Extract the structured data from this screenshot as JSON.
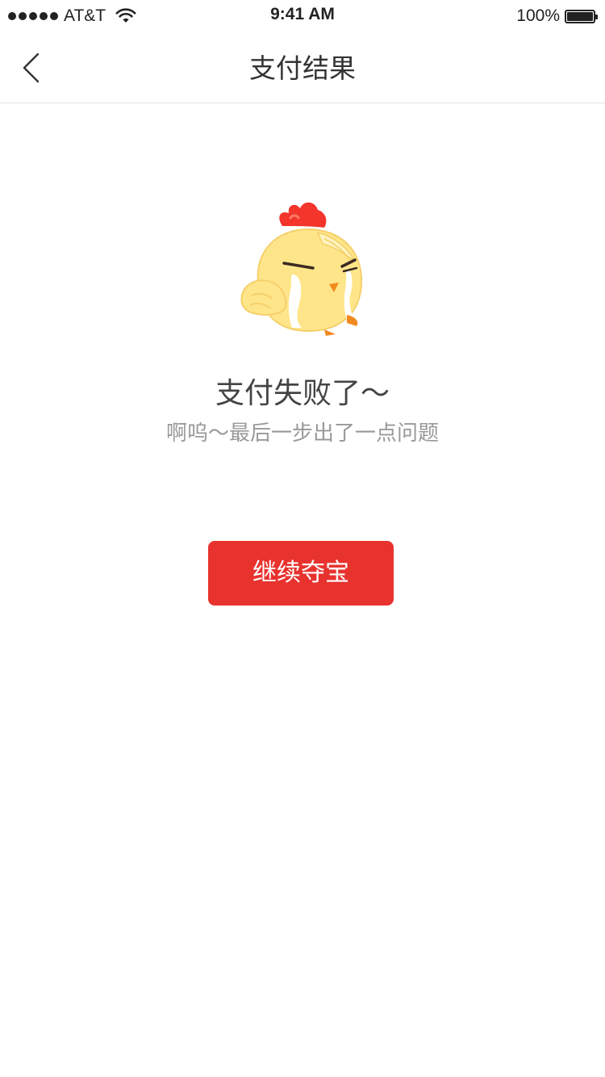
{
  "status_bar": {
    "carrier": "AT&T",
    "time": "9:41 AM",
    "battery": "100%"
  },
  "nav": {
    "title": "支付结果",
    "back_icon": "chevron-left-icon"
  },
  "result": {
    "illustration": "crying-chick-icon",
    "title": "支付失败了～",
    "subtitle": "啊呜～最后一步出了一点问题"
  },
  "actions": {
    "continue_label": "继续夺宝"
  },
  "colors": {
    "accent": "#e8322e",
    "title_text": "#444444",
    "subtitle_text": "#999999",
    "divider": "#e3e3e3"
  }
}
